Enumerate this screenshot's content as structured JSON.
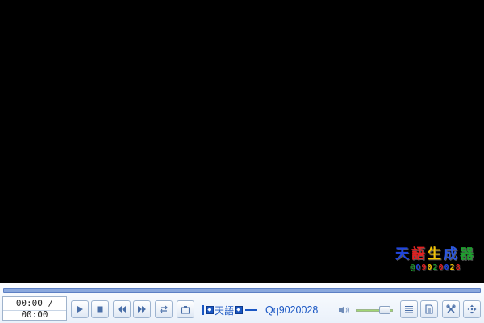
{
  "video": {
    "watermark": {
      "chars": [
        {
          "text": "天",
          "color": "#1e44e0"
        },
        {
          "text": "語",
          "color": "#e52020"
        },
        {
          "text": "生",
          "color": "#f2c200"
        },
        {
          "text": "成",
          "color": "#2b57e0"
        },
        {
          "text": "器",
          "color": "#1e9e2e"
        }
      ],
      "qq_chars": [
        {
          "text": "@",
          "color": "#1e9e2e"
        },
        {
          "text": "Q",
          "color": "#1e44e0"
        },
        {
          "text": "9",
          "color": "#e52020"
        },
        {
          "text": "0",
          "color": "#f2c200"
        },
        {
          "text": "2",
          "color": "#1e9e2e"
        },
        {
          "text": "0",
          "color": "#e52020"
        },
        {
          "text": "0",
          "color": "#1e44e0"
        },
        {
          "text": "2",
          "color": "#f2c200"
        },
        {
          "text": "8",
          "color": "#e52020"
        }
      ]
    }
  },
  "controls": {
    "progress": 0,
    "time": "00:00 / 00:00",
    "buttons": [
      {
        "name": "play",
        "icon": "play-icon"
      },
      {
        "name": "stop",
        "icon": "stop-icon"
      },
      {
        "name": "rewind",
        "icon": "rewind-icon"
      },
      {
        "name": "fast-forward",
        "icon": "fast-forward-icon"
      },
      {
        "name": "repeat",
        "icon": "repeat-icon"
      },
      {
        "name": "snapshot",
        "icon": "snapshot-icon"
      }
    ],
    "now_playing": {
      "logo_text": "天語",
      "title": "Qq9020028"
    },
    "volume": 0.78,
    "right_buttons": [
      {
        "name": "playlist",
        "icon": "list-icon"
      },
      {
        "name": "document",
        "icon": "document-icon"
      },
      {
        "name": "settings",
        "icon": "tools-icon"
      },
      {
        "name": "fullscreen",
        "icon": "fullscreen-icon"
      }
    ],
    "accent": "#1a57c4",
    "progress_color": "#5678c0"
  }
}
